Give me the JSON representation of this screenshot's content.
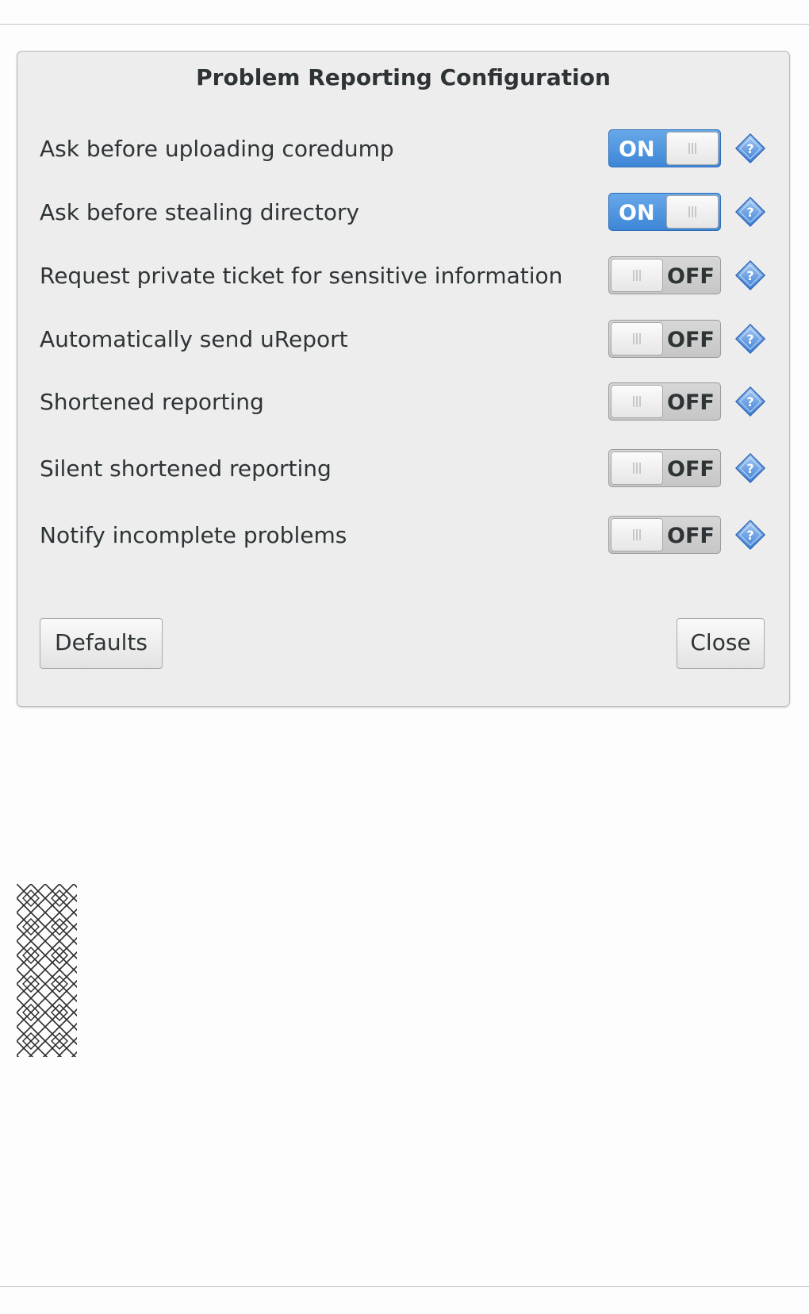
{
  "dialog": {
    "title": "Problem Reporting Configuration",
    "options": [
      {
        "label": "Ask before uploading coredump",
        "state": "ON"
      },
      {
        "label": "Ask before stealing directory",
        "state": "ON"
      },
      {
        "label": "Request private ticket for sensitive information",
        "state": "OFF"
      },
      {
        "label": "Automatically send uReport",
        "state": "OFF"
      },
      {
        "label": "Shortened reporting",
        "state": "OFF"
      },
      {
        "label": "Silent shortened reporting",
        "state": "OFF"
      },
      {
        "label": "Notify incomplete problems",
        "state": "OFF"
      }
    ],
    "help_icon": "help-diamond-icon",
    "buttons": {
      "defaults": "Defaults",
      "close": "Close"
    }
  },
  "colors": {
    "switch_on": "#4a90e0",
    "switch_off": "#cccccc",
    "help_icon": "#3d7ed8",
    "dialog_bg": "#ededed"
  },
  "logo_icon": "crosshatch-pattern-logo"
}
